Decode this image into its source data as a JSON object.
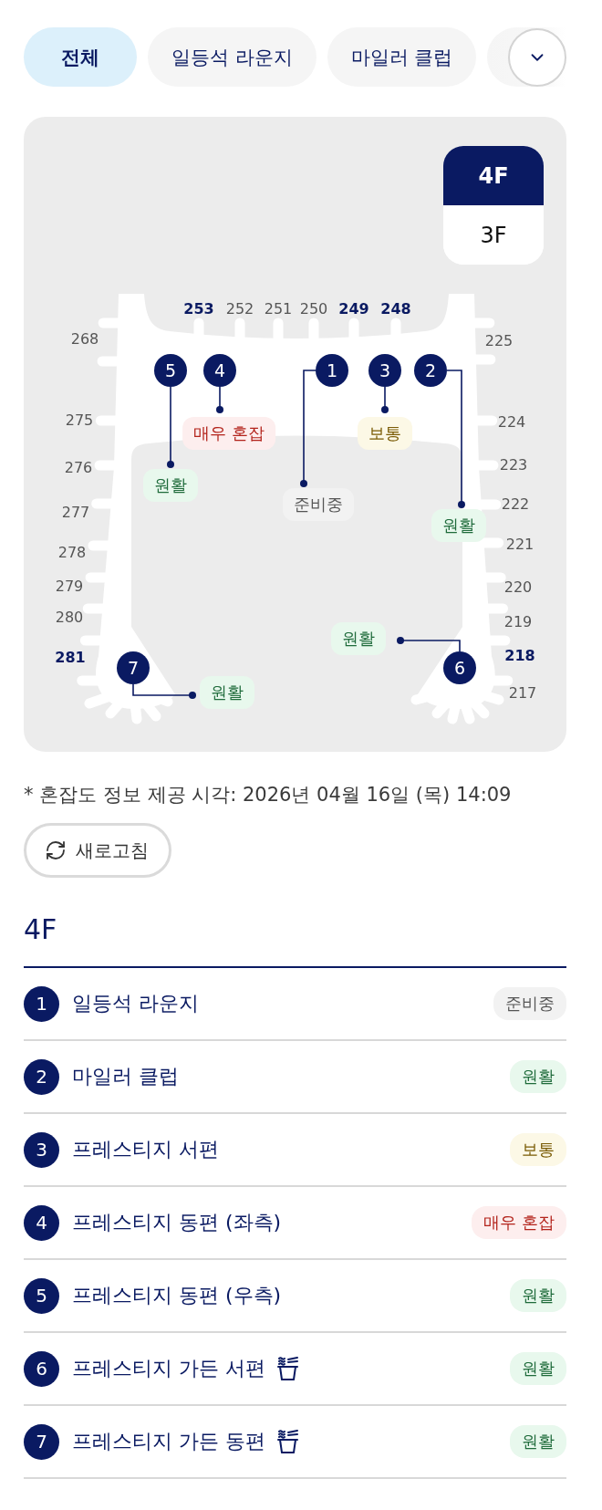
{
  "filter_chips": [
    {
      "label": "전체",
      "selected": true
    },
    {
      "label": "일등석 라운지",
      "selected": false
    },
    {
      "label": "마일러 클럽",
      "selected": false
    }
  ],
  "floor_tabs": [
    {
      "label": "4F",
      "selected": true
    },
    {
      "label": "3F",
      "selected": false
    }
  ],
  "map": {
    "gates": {
      "top": [
        {
          "label": "253",
          "highlighted": true
        },
        {
          "label": "252",
          "highlighted": false
        },
        {
          "label": "251",
          "highlighted": false
        },
        {
          "label": "250",
          "highlighted": false
        },
        {
          "label": "249",
          "highlighted": true
        },
        {
          "label": "248",
          "highlighted": true
        }
      ],
      "left": [
        {
          "label": "268",
          "highlighted": false
        },
        {
          "label": "275",
          "highlighted": false
        },
        {
          "label": "276",
          "highlighted": false
        },
        {
          "label": "277",
          "highlighted": false
        },
        {
          "label": "278",
          "highlighted": false
        },
        {
          "label": "279",
          "highlighted": false
        },
        {
          "label": "280",
          "highlighted": false
        },
        {
          "label": "281",
          "highlighted": true
        }
      ],
      "right": [
        {
          "label": "225",
          "highlighted": false
        },
        {
          "label": "224",
          "highlighted": false
        },
        {
          "label": "223",
          "highlighted": false
        },
        {
          "label": "222",
          "highlighted": false
        },
        {
          "label": "221",
          "highlighted": false
        },
        {
          "label": "220",
          "highlighted": false
        },
        {
          "label": "219",
          "highlighted": false
        },
        {
          "label": "218",
          "highlighted": true
        },
        {
          "label": "217",
          "highlighted": false
        }
      ]
    },
    "markers": [
      {
        "number": "5",
        "status": {
          "text": "원활",
          "kind": "smooth"
        }
      },
      {
        "number": "4",
        "status": {
          "text": "매우 혼잡",
          "kind": "busy"
        }
      },
      {
        "number": "1",
        "status": {
          "text": "준비중",
          "kind": "preparing"
        }
      },
      {
        "number": "3",
        "status": {
          "text": "보통",
          "kind": "normal"
        }
      },
      {
        "number": "2",
        "status": {
          "text": "원활",
          "kind": "smooth"
        }
      },
      {
        "number": "7",
        "status": {
          "text": "원활",
          "kind": "smooth"
        }
      },
      {
        "number": "6",
        "status": {
          "text": "원활",
          "kind": "smooth"
        }
      }
    ]
  },
  "timestamp": "* 혼잡도 정보 제공 시각: 2026년 04월 16일 (목) 14:09",
  "refresh_button": {
    "label": "새로고침"
  },
  "section_title": "4F",
  "lounges": [
    {
      "number": "1",
      "name": "일등석 라운지",
      "snack_icon": false,
      "status": {
        "text": "준비중",
        "kind": "preparing"
      }
    },
    {
      "number": "2",
      "name": "마일러 클럽",
      "snack_icon": false,
      "status": {
        "text": "원활",
        "kind": "smooth"
      }
    },
    {
      "number": "3",
      "name": "프레스티지 서편",
      "snack_icon": false,
      "status": {
        "text": "보통",
        "kind": "normal"
      }
    },
    {
      "number": "4",
      "name": "프레스티지 동편 (좌측)",
      "snack_icon": false,
      "status": {
        "text": "매우 혼잡",
        "kind": "busy"
      }
    },
    {
      "number": "5",
      "name": "프레스티지 동편 (우측)",
      "snack_icon": false,
      "status": {
        "text": "원활",
        "kind": "smooth"
      }
    },
    {
      "number": "6",
      "name": "프레스티지 가든 서편",
      "snack_icon": true,
      "status": {
        "text": "원활",
        "kind": "smooth"
      }
    },
    {
      "number": "7",
      "name": "프레스티지 가든 동편",
      "snack_icon": true,
      "status": {
        "text": "원활",
        "kind": "smooth"
      }
    }
  ]
}
